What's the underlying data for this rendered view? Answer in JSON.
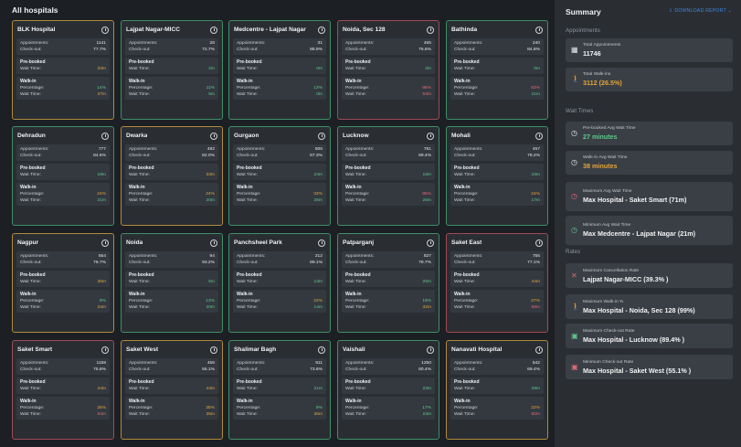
{
  "main": {
    "title": "All hospitals"
  },
  "labels": {
    "appointments": "Appointments:",
    "checkout": "Check-out:",
    "prebooked": "Pre-booked",
    "wait_time": "Wait Time:",
    "walkin": "Walk-in",
    "percentage": "Percentage:"
  },
  "hospitals": [
    {
      "name": "BLK Hospital",
      "appointments": "1141",
      "checkout": "77.7%",
      "pre_wait": "33m",
      "walk_pct": "14%",
      "walk_wait": "37m",
      "border": "orange",
      "pre_color": "o",
      "pct_color": "g",
      "walk_color": "o"
    },
    {
      "name": "Lajpat Nagar-MICC",
      "appointments": "28",
      "checkout": "72.7%",
      "pre_wait": "2m",
      "walk_pct": "11%",
      "walk_wait": "5m",
      "border": "green",
      "pre_color": "g",
      "pct_color": "g",
      "walk_color": "g"
    },
    {
      "name": "Medcentre - Lajpat Nagar",
      "appointments": "31",
      "checkout": "88.9%",
      "pre_wait": "0m",
      "walk_pct": "13%",
      "walk_wait": "0m",
      "border": "green",
      "pre_color": "g",
      "pct_color": "g",
      "walk_color": "g"
    },
    {
      "name": "Noida, Sec 128",
      "appointments": "455",
      "checkout": "75.6%",
      "pre_wait": "3m",
      "walk_pct": "98%",
      "walk_wait": "53m",
      "border": "red",
      "pre_color": "g",
      "pct_color": "r",
      "walk_color": "r"
    },
    {
      "name": "Bathinda",
      "appointments": "240",
      "checkout": "84.8%",
      "pre_wait": "0m",
      "walk_pct": "83%",
      "walk_wait": "21m",
      "border": "green",
      "pre_color": "g",
      "pct_color": "r",
      "walk_color": "g"
    },
    {
      "name": "Dehradun",
      "appointments": "777",
      "checkout": "84.6%",
      "pre_wait": "19m",
      "walk_pct": "24%",
      "walk_wait": "21m",
      "border": "green",
      "pre_color": "g",
      "pct_color": "o",
      "walk_color": "g"
    },
    {
      "name": "Dwarka",
      "appointments": "492",
      "checkout": "82.0%",
      "pre_wait": "33m",
      "walk_pct": "24%",
      "walk_wait": "20m",
      "border": "orange",
      "pre_color": "o",
      "pct_color": "o",
      "walk_color": "g"
    },
    {
      "name": "Gurgaon",
      "appointments": "506",
      "checkout": "87.3%",
      "pre_wait": "24m",
      "walk_pct": "33%",
      "walk_wait": "25m",
      "border": "green",
      "pre_color": "g",
      "pct_color": "o",
      "walk_color": "g"
    },
    {
      "name": "Lucknow",
      "appointments": "761",
      "checkout": "89.4%",
      "pre_wait": "16m",
      "walk_pct": "85%",
      "walk_wait": "26m",
      "border": "green",
      "pre_color": "g",
      "pct_color": "r",
      "walk_color": "g"
    },
    {
      "name": "Mohali",
      "appointments": "457",
      "checkout": "78.2%",
      "pre_wait": "19m",
      "walk_pct": "24%",
      "walk_wait": "17m",
      "border": "green",
      "pre_color": "g",
      "pct_color": "o",
      "walk_color": "g"
    },
    {
      "name": "Nagpur",
      "appointments": "554",
      "checkout": "76.7%",
      "pre_wait": "36m",
      "walk_pct": "8%",
      "walk_wait": "34m",
      "border": "orange",
      "pre_color": "o",
      "pct_color": "g",
      "walk_color": "o"
    },
    {
      "name": "Noida",
      "appointments": "94",
      "checkout": "93.2%",
      "pre_wait": "5m",
      "walk_pct": "13%",
      "walk_wait": "20m",
      "border": "green",
      "pre_color": "g",
      "pct_color": "g",
      "walk_color": "g"
    },
    {
      "name": "Panchsheel Park",
      "appointments": "212",
      "checkout": "89.1%",
      "pre_wait": "13m",
      "walk_pct": "22%",
      "walk_wait": "14m",
      "border": "green",
      "pre_color": "g",
      "pct_color": "o",
      "walk_color": "g"
    },
    {
      "name": "Patparganj",
      "appointments": "827",
      "checkout": "78.7%",
      "pre_wait": "25m",
      "walk_pct": "19%",
      "walk_wait": "32m",
      "border": "green",
      "pre_color": "g",
      "pct_color": "g",
      "walk_color": "o"
    },
    {
      "name": "Saket East",
      "appointments": "755",
      "checkout": "77.1%",
      "pre_wait": "44m",
      "walk_pct": "27%",
      "walk_wait": "59m",
      "border": "red",
      "pre_color": "o",
      "pct_color": "o",
      "walk_color": "r"
    },
    {
      "name": "Saket Smart",
      "appointments": "1159",
      "checkout": "75.8%",
      "pre_wait": "44m",
      "walk_pct": "25%",
      "walk_wait": "64m",
      "border": "red",
      "pre_color": "o",
      "pct_color": "o",
      "walk_color": "r"
    },
    {
      "name": "Saket West",
      "appointments": "456",
      "checkout": "55.1%",
      "pre_wait": "44m",
      "walk_pct": "35%",
      "walk_wait": "35m",
      "border": "orange",
      "pre_color": "o",
      "pct_color": "o",
      "walk_color": "o"
    },
    {
      "name": "Shalimar Bagh",
      "appointments": "911",
      "checkout": "73.6%",
      "pre_wait": "21m",
      "walk_pct": "9%",
      "walk_wait": "36m",
      "border": "green",
      "pre_color": "g",
      "pct_color": "g",
      "walk_color": "o"
    },
    {
      "name": "Vaishali",
      "appointments": "1250",
      "checkout": "80.4%",
      "pre_wait": "23m",
      "walk_pct": "17%",
      "walk_wait": "23m",
      "border": "green",
      "pre_color": "g",
      "pct_color": "g",
      "walk_color": "g"
    },
    {
      "name": "Nanavati Hospital",
      "appointments": "542",
      "checkout": "69.4%",
      "pre_wait": "29m",
      "walk_pct": "22%",
      "walk_wait": "60m",
      "border": "orange",
      "pre_color": "g",
      "pct_color": "o",
      "walk_color": "r"
    }
  ],
  "summary": {
    "title": "Summary",
    "download": "DOWNLOAD REPORT",
    "sections": {
      "appointments": "Appointments",
      "wait_times": "Wait Times",
      "rates": "Rates"
    },
    "cards": [
      {
        "label": "Total Appointments",
        "value": "11746",
        "icon": "calendar-icon",
        "color": ""
      },
      {
        "label": "Total Walk-ins",
        "value": "3112 (26.5%)",
        "icon": "walking-person-icon",
        "color": "o"
      },
      {
        "label": "Pre-booked Avg Wait Time",
        "value": "27 minutes",
        "icon": "clock-icon",
        "color": "g"
      },
      {
        "label": "Walk-in Avg Wait Time",
        "value": "38 minutes",
        "icon": "clock-icon",
        "color": "o"
      },
      {
        "label": "Maximum Avg Wait Time",
        "value": "Max Hospital - Saket Smart (71m)",
        "icon": "clock-alert-icon",
        "color": ""
      },
      {
        "label": "Minimum Avg Wait Time",
        "value": "Max Medcentre - Lajpat Nagar (21m)",
        "icon": "clock-check-icon",
        "color": ""
      },
      {
        "label": "Maximum Cancellation Rate",
        "value": "Lajpat Nagar-MICC (39.3% )",
        "icon": "cancel-icon",
        "color": ""
      },
      {
        "label": "Maximum Walk-in %",
        "value": "Max Hospital - Noida, Sec 128 (99%)",
        "icon": "walking-person-icon",
        "color": ""
      },
      {
        "label": "Maximum Check-out Rate",
        "value": "Max Hospital - Lucknow (89.4% )",
        "icon": "checkout-up-icon",
        "color": ""
      },
      {
        "label": "Minimum Check-out Rate",
        "value": "Max Hospital - Saket West (55.1% )",
        "icon": "checkout-down-icon",
        "color": ""
      }
    ]
  },
  "colors": {
    "green": "#3f8f66",
    "orange": "#b08a3a",
    "red": "#a04a55",
    "accent_blue": "#3d86e0",
    "value_green": "#5cc88a",
    "value_orange": "#e0a53c",
    "value_red": "#e06a74"
  }
}
